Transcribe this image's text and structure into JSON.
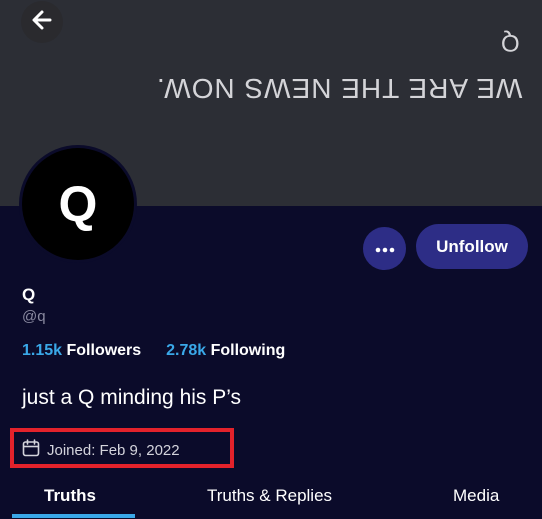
{
  "banner": {
    "mirrored_letter": "Q",
    "mirrored_text": "WE ARE THE NEWS NOW."
  },
  "profile": {
    "avatar_letter": "Q",
    "display_name": "Q",
    "handle": "@q",
    "followers_count": "1.15k",
    "followers_label": "Followers",
    "following_count": "2.78k",
    "following_label": "Following",
    "bio": "just a Q minding his P’s",
    "joined": "Joined: Feb 9, 2022"
  },
  "actions": {
    "more_icon": "ellipsis-icon",
    "unfollow_label": "Unfollow"
  },
  "tabs": [
    {
      "label": "Truths",
      "active": true
    },
    {
      "label": "Truths & Replies",
      "active": false
    },
    {
      "label": "Media",
      "active": false
    }
  ],
  "colors": {
    "background": "#0b0b2a",
    "banner": "#2c2e35",
    "accent_button": "#2d2d86",
    "link_blue": "#3aa8e8",
    "highlight_red": "#e3222b"
  }
}
